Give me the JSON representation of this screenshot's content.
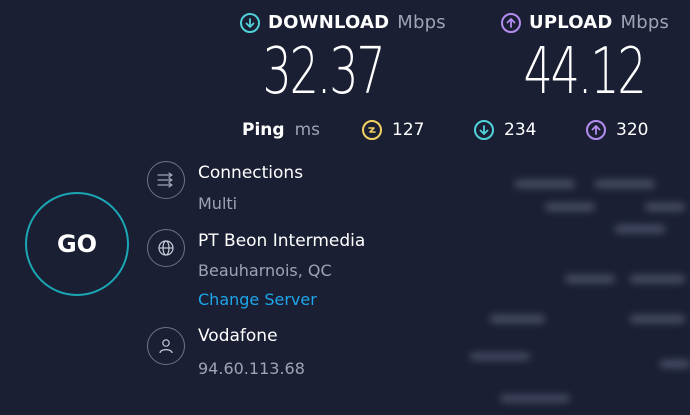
{
  "download": {
    "label": "DOWNLOAD",
    "unit": "Mbps",
    "value": "32.37",
    "icon": "download-arrow-icon",
    "color": "#4fd1d9"
  },
  "upload": {
    "label": "UPLOAD",
    "unit": "Mbps",
    "value": "44.12",
    "icon": "upload-arrow-icon",
    "color": "#b38cf0"
  },
  "ping": {
    "label": "Ping",
    "unit": "ms",
    "idle": {
      "value": "127",
      "icon": "ping-lightning-icon",
      "color": "#f2d263"
    },
    "download": {
      "value": "234",
      "icon": "download-arrow-icon",
      "color": "#4fd1d9"
    },
    "upload": {
      "value": "320",
      "icon": "upload-arrow-icon",
      "color": "#b38cf0"
    }
  },
  "go_button": {
    "label": "GO",
    "color": "#1ba6b3"
  },
  "connections": {
    "title": "Connections",
    "value": "Multi",
    "icon": "connections-arrows-icon"
  },
  "server": {
    "title": "PT Beon Intermedia",
    "location": "Beauharnois, QC",
    "change_label": "Change Server",
    "icon": "globe-icon",
    "link_color": "#1ea6ea"
  },
  "provider": {
    "title": "Vodafone",
    "ip": "94.60.113.68",
    "icon": "user-icon"
  },
  "background_color": "#1a1f33"
}
